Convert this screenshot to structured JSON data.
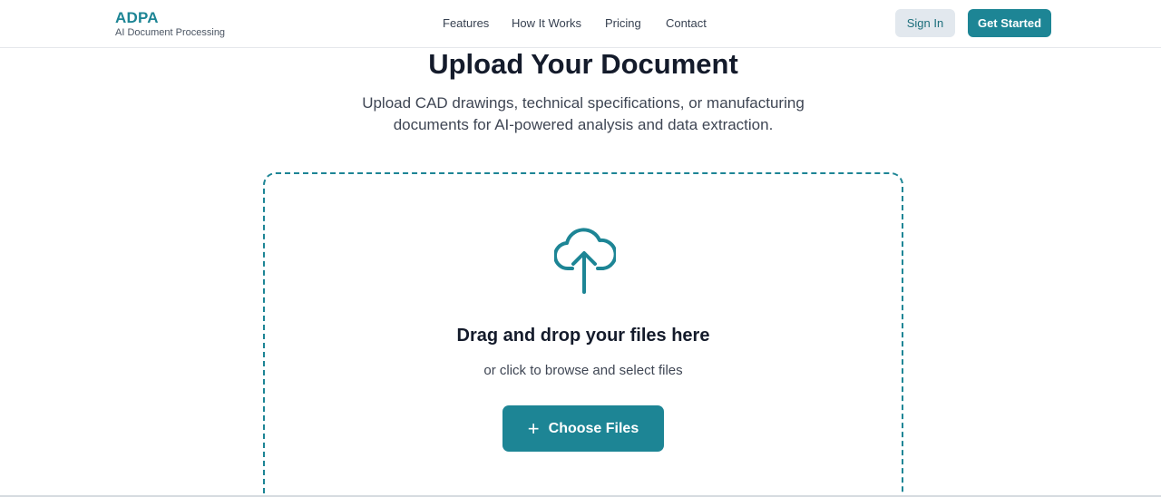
{
  "brand": {
    "name": "ADPA",
    "tagline": "AI Document Processing"
  },
  "nav": {
    "links": [
      {
        "label": "Features"
      },
      {
        "label": "How It Works"
      },
      {
        "label": "Pricing"
      },
      {
        "label": "Contact"
      }
    ],
    "sign_in_label": "Sign In",
    "get_started_label": "Get Started"
  },
  "main": {
    "title": "Upload Your Document",
    "subtitle": "Upload CAD drawings, technical specifications, or manufacturing documents for AI-powered analysis and data extraction."
  },
  "dropzone": {
    "icon": "cloud-upload-icon",
    "title": "Drag and drop your files here",
    "subtitle": "or click to browse and select files",
    "button_icon": "plus-icon",
    "button_label": "Choose Files"
  },
  "colors": {
    "accent": "#1d8595",
    "secondary_button_bg": "#e2e8ee",
    "heading": "#141b2b"
  }
}
